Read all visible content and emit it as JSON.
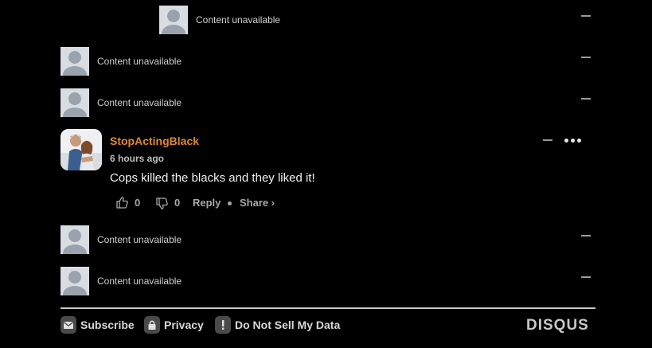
{
  "placeholders": [
    {
      "text": "Content unavailable"
    },
    {
      "text": "Content unavailable"
    },
    {
      "text": "Content unavailable"
    },
    {
      "text": "Content unavailable"
    },
    {
      "text": "Content unavailable"
    }
  ],
  "comment": {
    "username": "StopActingBlack",
    "timestamp": "6 hours ago",
    "message": "Cops killed the blacks and they liked it!",
    "upvotes": "0",
    "downvotes": "0",
    "reply_label": "Reply",
    "share_label": "Share ›"
  },
  "footer": {
    "subscribe_label": "Subscribe",
    "privacy_label": "Privacy",
    "dnsmpi_label": "Do Not Sell My Data",
    "brand": "DISQUS"
  },
  "colors": {
    "username": "#e08a2a",
    "background": "#000000"
  }
}
